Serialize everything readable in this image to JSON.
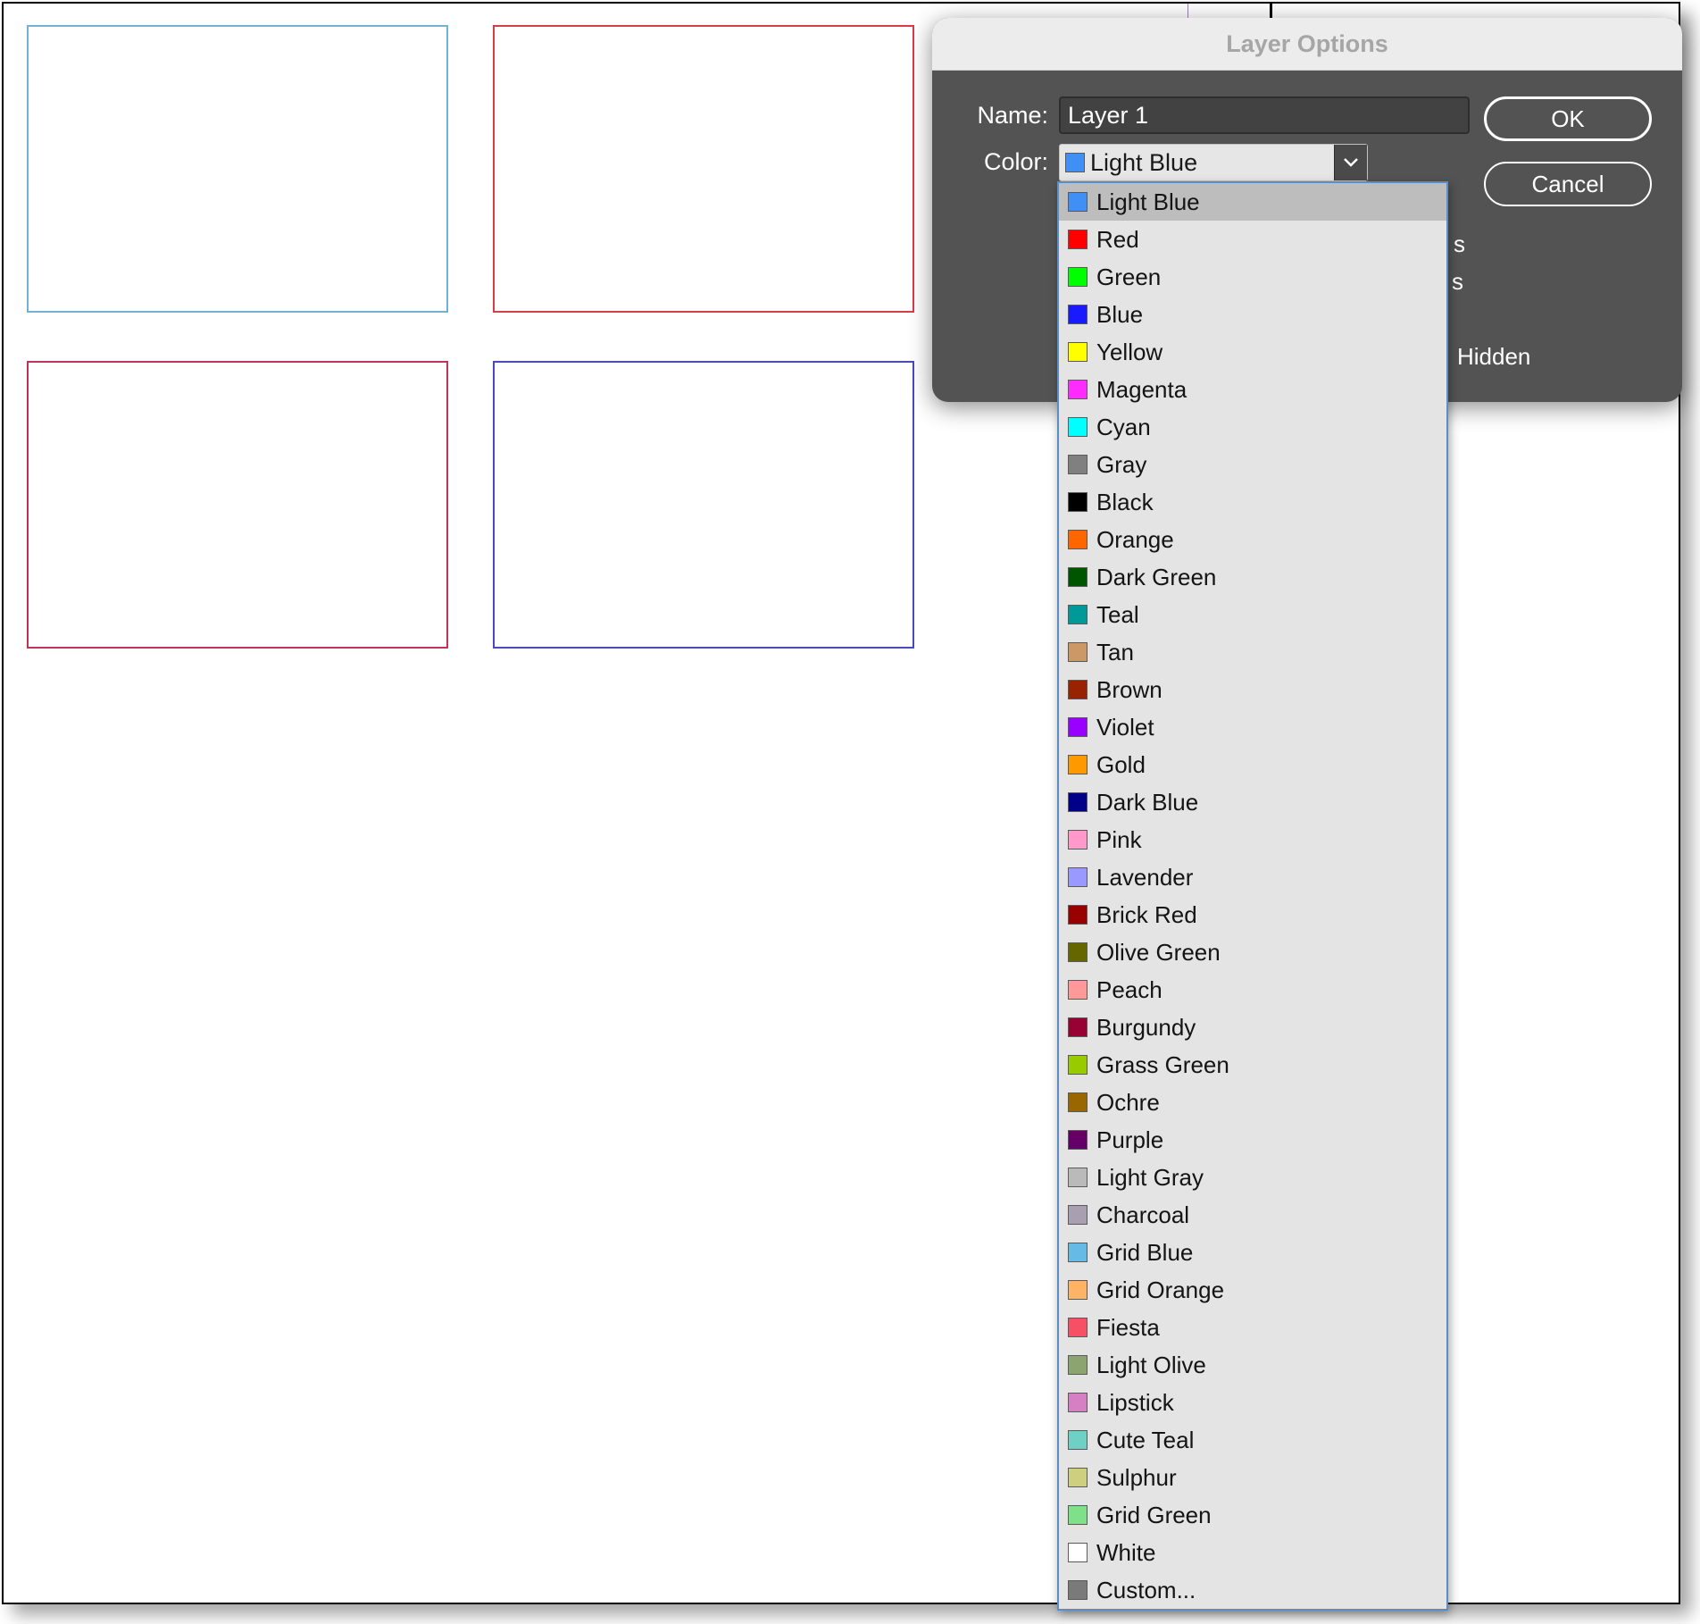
{
  "dialog": {
    "title": "Layer Options",
    "name_label": "Name:",
    "name_value": "Layer 1",
    "color_label": "Color:",
    "color_value": "Light Blue",
    "color_value_swatch": "#3f8ff5",
    "ok_label": "OK",
    "cancel_label": "Cancel",
    "partial_text_1": "s",
    "partial_text_2": "s",
    "hidden_label": "Hidden"
  },
  "colors": {
    "dialog_bg": "#535353",
    "dropdown_bg": "#e4e4e4",
    "dropdown_border": "#5b8ec7",
    "selected_row": "#bdbdbd"
  },
  "page_boxes": [
    {
      "name": "frame-light-blue",
      "color": "#6fb3d8"
    },
    {
      "name": "frame-red",
      "color": "#d83b4a"
    },
    {
      "name": "frame-crimson",
      "color": "#c0335a"
    },
    {
      "name": "frame-purple-blue",
      "color": "#4a48c0"
    }
  ],
  "color_options": [
    {
      "label": "Light Blue",
      "swatch": "#3f8ff5",
      "selected": true
    },
    {
      "label": "Red",
      "swatch": "#ff0000"
    },
    {
      "label": "Green",
      "swatch": "#00ff00"
    },
    {
      "label": "Blue",
      "swatch": "#1a1aff"
    },
    {
      "label": "Yellow",
      "swatch": "#ffff00"
    },
    {
      "label": "Magenta",
      "swatch": "#ff2bff"
    },
    {
      "label": "Cyan",
      "swatch": "#00ffff"
    },
    {
      "label": "Gray",
      "swatch": "#808080"
    },
    {
      "label": "Black",
      "swatch": "#000000"
    },
    {
      "label": "Orange",
      "swatch": "#ff6600"
    },
    {
      "label": "Dark Green",
      "swatch": "#005500"
    },
    {
      "label": "Teal",
      "swatch": "#009999"
    },
    {
      "label": "Tan",
      "swatch": "#cc9966"
    },
    {
      "label": "Brown",
      "swatch": "#992200"
    },
    {
      "label": "Violet",
      "swatch": "#9900ff"
    },
    {
      "label": "Gold",
      "swatch": "#ff9900"
    },
    {
      "label": "Dark Blue",
      "swatch": "#000088"
    },
    {
      "label": "Pink",
      "swatch": "#ff99cc"
    },
    {
      "label": "Lavender",
      "swatch": "#9999ff"
    },
    {
      "label": "Brick Red",
      "swatch": "#990000"
    },
    {
      "label": "Olive Green",
      "swatch": "#666600"
    },
    {
      "label": "Peach",
      "swatch": "#ff9999"
    },
    {
      "label": "Burgundy",
      "swatch": "#990033"
    },
    {
      "label": "Grass Green",
      "swatch": "#99cc00"
    },
    {
      "label": "Ochre",
      "swatch": "#996600"
    },
    {
      "label": "Purple",
      "swatch": "#660066"
    },
    {
      "label": "Light Gray",
      "swatch": "#bababa"
    },
    {
      "label": "Charcoal",
      "swatch": "#aa9fb0"
    },
    {
      "label": "Grid Blue",
      "swatch": "#66bbe6"
    },
    {
      "label": "Grid Orange",
      "swatch": "#ffb366"
    },
    {
      "label": "Fiesta",
      "swatch": "#f74f64"
    },
    {
      "label": "Light Olive",
      "swatch": "#8ca470"
    },
    {
      "label": "Lipstick",
      "swatch": "#d77fc4"
    },
    {
      "label": "Cute Teal",
      "swatch": "#6fd1c6"
    },
    {
      "label": "Sulphur",
      "swatch": "#cfcf80"
    },
    {
      "label": "Grid Green",
      "swatch": "#7fe08a"
    },
    {
      "label": "White",
      "swatch": "#ffffff"
    },
    {
      "label": "Custom...",
      "swatch": "#7a7a7a"
    }
  ]
}
